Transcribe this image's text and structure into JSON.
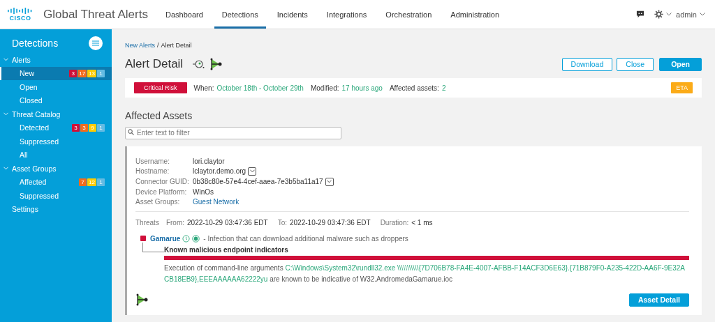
{
  "header": {
    "logo": "CISCO",
    "title": "Global Threat Alerts",
    "user": "admin"
  },
  "nav": [
    {
      "label": "Dashboard",
      "selected": false
    },
    {
      "label": "Detections",
      "selected": true
    },
    {
      "label": "Incidents",
      "selected": false
    },
    {
      "label": "Integrations",
      "selected": false
    },
    {
      "label": "Orchestration",
      "selected": false
    },
    {
      "label": "Administration",
      "selected": false
    }
  ],
  "sidebar": {
    "title": "Detections",
    "items": [
      {
        "label": "Alerts",
        "expanded": true,
        "children": [
          {
            "label": "New",
            "selected": true,
            "badges": [
              {
                "text": "3",
                "color": "#d0103a"
              },
              {
                "text": "17",
                "color": "#f26b1d"
              },
              {
                "text": "13",
                "color": "#ffcc00"
              },
              {
                "text": "1",
                "color": "#64bbe3"
              }
            ]
          },
          {
            "label": "Open",
            "selected": false
          },
          {
            "label": "Closed",
            "selected": false
          }
        ]
      },
      {
        "label": "Threat Catalog",
        "expanded": true,
        "children": [
          {
            "label": "Detected",
            "selected": false,
            "badges": [
              {
                "text": "3",
                "color": "#d0103a"
              },
              {
                "text": "3",
                "color": "#f26b1d"
              },
              {
                "text": "9",
                "color": "#ffcc00"
              },
              {
                "text": "1",
                "color": "#64bbe3"
              }
            ]
          },
          {
            "label": "Suppressed",
            "selected": false
          },
          {
            "label": "All",
            "selected": false
          }
        ]
      },
      {
        "label": "Asset Groups",
        "expanded": true,
        "children": [
          {
            "label": "Affected",
            "selected": false,
            "badges": [
              {
                "text": "7",
                "color": "#f26b1d"
              },
              {
                "text": "12",
                "color": "#ffcc00"
              },
              {
                "text": "1",
                "color": "#64bbe3"
              }
            ]
          },
          {
            "label": "Suppressed",
            "selected": false
          }
        ]
      },
      {
        "label": "Settings"
      }
    ]
  },
  "breadcrumb": {
    "link": "New Alerts",
    "separator": "/",
    "current": "Alert Detail"
  },
  "page_title": "Alert Detail",
  "buttons": [
    {
      "label": "Download",
      "kind": "outline"
    },
    {
      "label": "Close",
      "kind": "outline"
    },
    {
      "label": "Open",
      "kind": "primary"
    }
  ],
  "summary": {
    "risk": "Critical Risk",
    "fields": [
      {
        "label": "When:",
        "value": "October 18th - October 29th"
      },
      {
        "label": "Modified:",
        "value": "17 hours ago"
      },
      {
        "label": "Affected assets:",
        "value": "2"
      }
    ],
    "tag": "ETA"
  },
  "assets": {
    "title": "Affected Assets",
    "filter": {
      "placeholder": "Enter text to filter"
    },
    "details": [
      {
        "label": "Username:",
        "value": "lori.claytor",
        "kind": "text"
      },
      {
        "label": "Hostname:",
        "value": "lclaytor.demo.org",
        "kind": "dropdown"
      },
      {
        "label": "Connector GUID:",
        "value": "0b38c80e-57e4-4cef-aaea-7e3b5ba11a17",
        "kind": "dropdown"
      },
      {
        "label": "Device Platform:",
        "value": "WinOs",
        "kind": "text"
      },
      {
        "label": "Asset Groups:",
        "value": "Guest Network",
        "kind": "link"
      }
    ],
    "threats": {
      "label": "Threats",
      "fields": [
        {
          "label": "From:",
          "value": "2022-10-29 03:47:36 EDT"
        },
        {
          "label": "To:",
          "value": "2022-10-29 03:47:36 EDT"
        },
        {
          "label": "Duration:",
          "value": "< 1 ms"
        }
      ]
    },
    "threat": {
      "name": "Gamarue",
      "color": "#d0103a",
      "description": "- Infection that can download additional malware such as droppers",
      "indicator_title": "Known malicious endpoint indicators",
      "indicator_prefix": "Execution of command-line arguments ",
      "indicator_code": "C:\\Windows\\System32\\rundll32.exe  \\\\\\\\\\\\\\\\\\\\\\{7D706B78-FA4E-4007-AFBB-F14ACF3D6E63}.{71B879F0-A235-422D-AA6F-9E32ACB18EB9},EEEAAAAAA62222yu",
      "indicator_suffix": " are known to be indicative of W32.AndromedaGamarue.ioc"
    },
    "detail_button": "Asset Detail"
  }
}
